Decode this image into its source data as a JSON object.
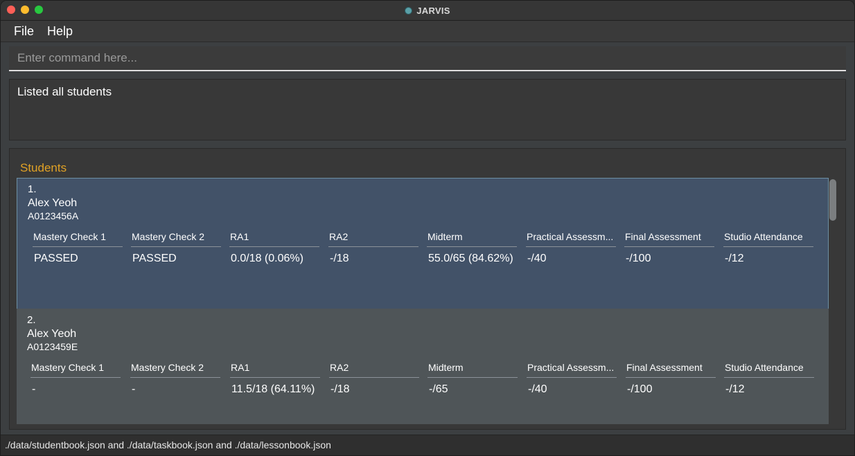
{
  "window": {
    "title": "JARVIS",
    "icon": "app-icon",
    "controls": [
      "close-icon",
      "minimize-icon",
      "maximize-icon"
    ]
  },
  "menu": {
    "file": "File",
    "help": "Help"
  },
  "command": {
    "placeholder": "Enter command here...",
    "value": ""
  },
  "result": {
    "message": "Listed all students"
  },
  "students": {
    "title": "Students",
    "items": [
      {
        "index": "1.",
        "name": "Alex Yeoh",
        "id": "A0123456A",
        "grades": [
          {
            "label": "Mastery Check 1",
            "value": "PASSED"
          },
          {
            "label": "Mastery Check 2",
            "value": "PASSED"
          },
          {
            "label": "RA1",
            "value": "0.0/18 (0.06%)"
          },
          {
            "label": "RA2",
            "value": "-/18"
          },
          {
            "label": "Midterm",
            "value": "55.0/65 (84.62%)"
          },
          {
            "label": "Practical Assessm...",
            "value": "-/40"
          },
          {
            "label": "Final Assessment",
            "value": "-/100"
          },
          {
            "label": "Studio Attendance",
            "value": "-/12"
          }
        ]
      },
      {
        "index": "2.",
        "name": "Alex Yeoh",
        "id": "A0123459E",
        "grades": [
          {
            "label": "Mastery Check 1",
            "value": "-"
          },
          {
            "label": "Mastery Check 2",
            "value": "-"
          },
          {
            "label": "RA1",
            "value": "11.5/18 (64.11%)"
          },
          {
            "label": "RA2",
            "value": "-/18"
          },
          {
            "label": "Midterm",
            "value": "-/65"
          },
          {
            "label": "Practical Assessm...",
            "value": "-/40"
          },
          {
            "label": "Final Assessment",
            "value": "-/100"
          },
          {
            "label": "Studio Attendance",
            "value": "-/12"
          }
        ]
      }
    ]
  },
  "status": {
    "path": "./data/studentbook.json and ./data/taskbook.json and ./data/lessonbook.json"
  },
  "colors": {
    "accent": "#e0a125",
    "selected_card": "#425268",
    "card": "#4f5558"
  }
}
